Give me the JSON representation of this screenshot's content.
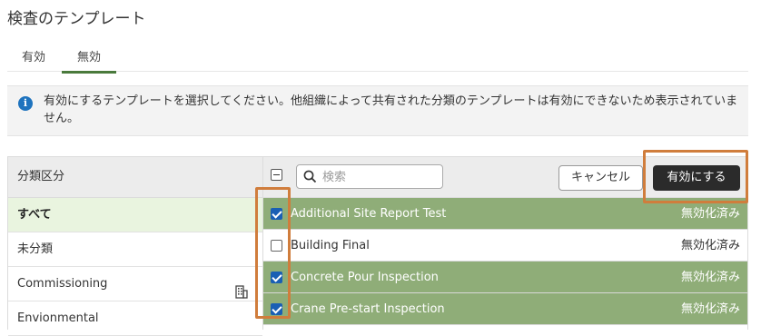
{
  "page": {
    "title": "検査のテンプレート"
  },
  "tabs": [
    {
      "label": "有効"
    },
    {
      "label": "無効"
    }
  ],
  "info": {
    "text": "有効にするテンプレートを選択してください。他組織によって共有された分類のテンプレートは有効にできないため表示されていません。"
  },
  "categories": {
    "header": "分類区分",
    "items": [
      {
        "label": "すべて"
      },
      {
        "label": "未分類"
      },
      {
        "label": "Commissioning"
      },
      {
        "label": "Envionmental"
      }
    ]
  },
  "toolbar": {
    "search_placeholder": "検索",
    "cancel_label": "キャンセル",
    "enable_label": "有効にする"
  },
  "templates": [
    {
      "name": "Additional Site Report Test",
      "status": "無効化済み",
      "checked": true
    },
    {
      "name": "Building Final",
      "status": "無効化済み",
      "checked": false
    },
    {
      "name": "Concrete Pour Inspection",
      "status": "無効化済み",
      "checked": true
    },
    {
      "name": "Crane Pre-start Inspection",
      "status": "無効化済み",
      "checked": true
    }
  ],
  "colors": {
    "selected_row": "#8fad78",
    "highlight": "#d07d3c",
    "active_tab": "#4a7a3c",
    "active_category": "#e9f4df"
  }
}
